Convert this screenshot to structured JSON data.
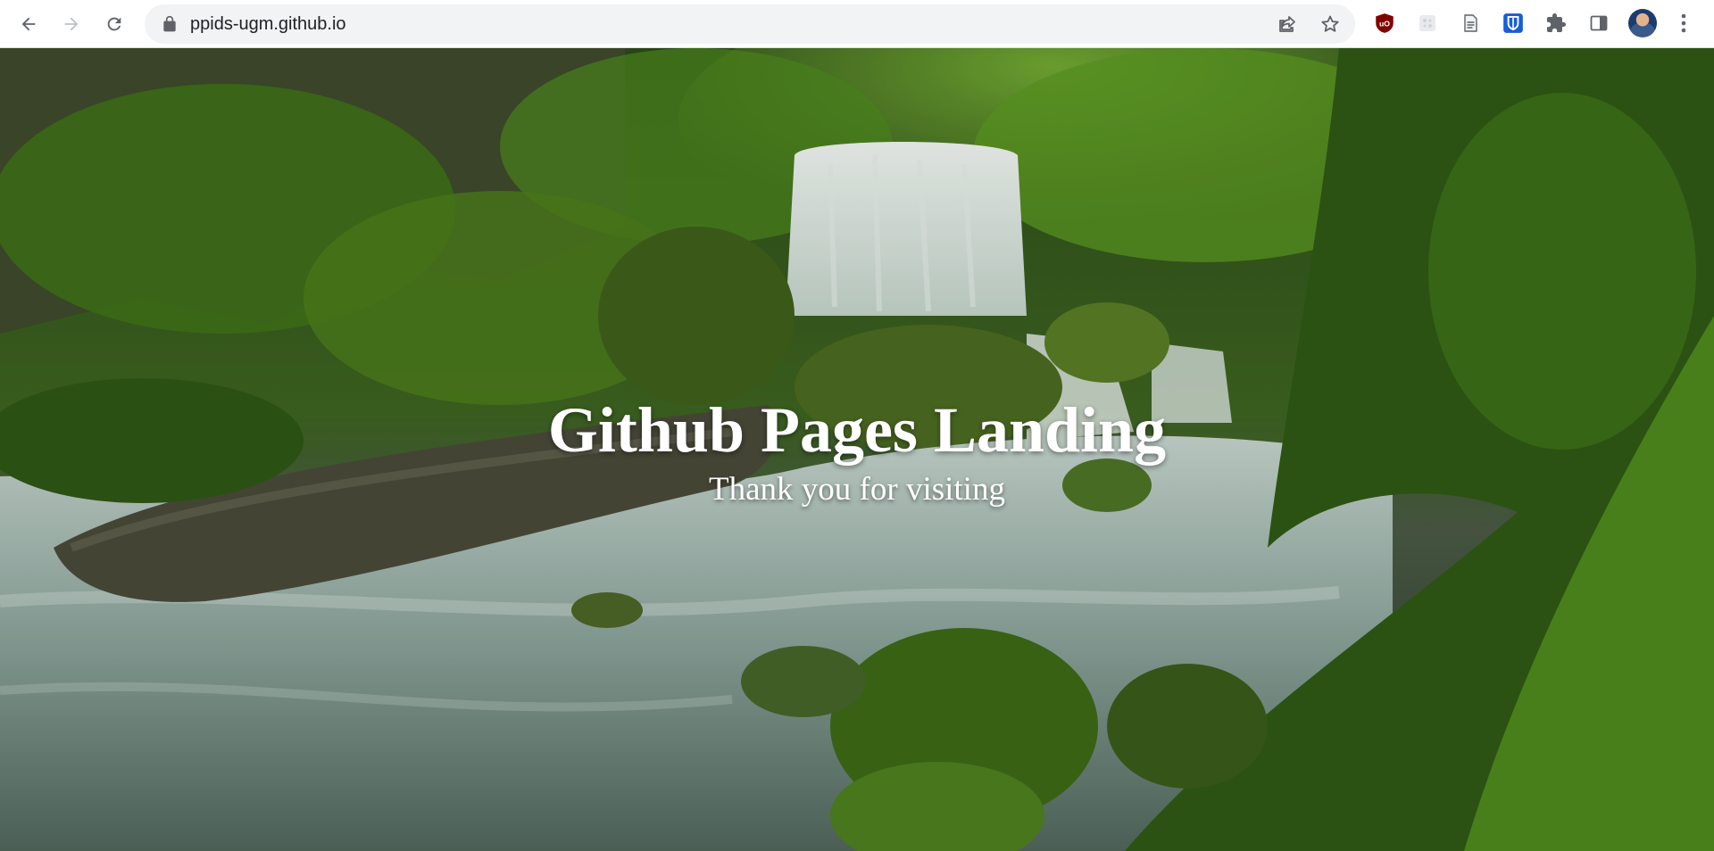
{
  "browser": {
    "url": "ppids-ugm.github.io",
    "icons": {
      "back": "back-arrow-icon",
      "forward": "forward-arrow-icon",
      "reload": "reload-icon",
      "lock": "lock-icon",
      "share": "share-icon",
      "bookmark": "star-icon",
      "extensions": [
        "ublock-origin-icon",
        "extension-grey-icon",
        "document-extension-icon",
        "bitwarden-icon",
        "puzzle-extensions-icon",
        "side-panel-icon"
      ],
      "menu": "more-vert-icon"
    },
    "colors": {
      "toolbar_bg": "#ffffff",
      "omnibox_bg": "#f1f3f4",
      "ublock": "#800000",
      "bitwarden": "#175ddc"
    }
  },
  "hero": {
    "title": "Github Pages Landing",
    "subtitle": "Thank you for visiting",
    "colors": {
      "text": "#ffffff",
      "foliage_dark": "#1f3d12",
      "foliage_light": "#6fae2a",
      "water": "#9fb7ad"
    }
  }
}
